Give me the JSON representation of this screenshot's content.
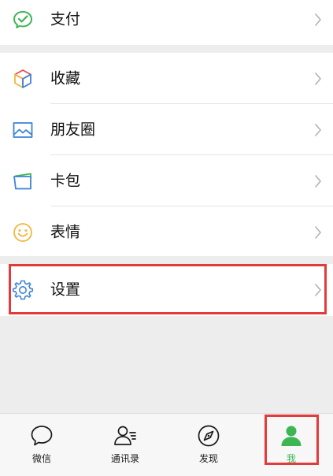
{
  "menu": {
    "pay": {
      "label": "支付",
      "icon": "wechat-pay-icon"
    },
    "favorites": {
      "label": "收藏",
      "icon": "cube-favorites-icon"
    },
    "moments": {
      "label": "朋友圈",
      "icon": "photo-landscape-icon"
    },
    "cards": {
      "label": "卡包",
      "icon": "card-wallet-icon"
    },
    "stickers": {
      "label": "表情",
      "icon": "smiley-icon"
    },
    "settings": {
      "label": "设置",
      "icon": "gear-icon"
    }
  },
  "tabbar": {
    "chats": {
      "label": "微信",
      "icon": "chat-bubble-icon"
    },
    "contacts": {
      "label": "通讯录",
      "icon": "contacts-icon"
    },
    "discover": {
      "label": "发现",
      "icon": "compass-icon"
    },
    "me": {
      "label": "我",
      "icon": "person-icon",
      "active": true
    }
  },
  "colors": {
    "accent": "#3db553",
    "highlight": "#e23b3b",
    "background": "#ededed"
  }
}
